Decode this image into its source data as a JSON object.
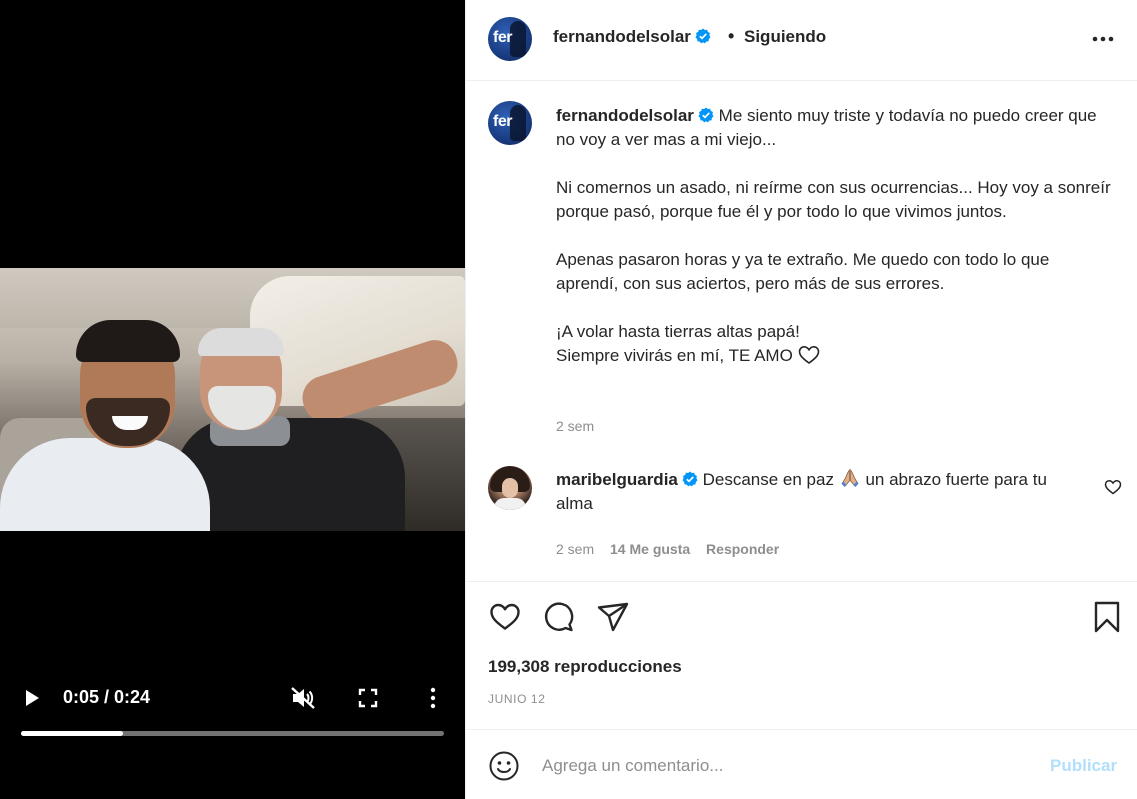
{
  "video": {
    "time_display": "0:05 / 0:24",
    "progress": 0.24,
    "muted": true
  },
  "header": {
    "username": "fernandodelsolar",
    "avatar_text": "fer",
    "separator": "•",
    "follow_status": "Siguiendo"
  },
  "caption": {
    "username": "fernandodelsolar",
    "paragraphs": [
      "Me siento muy triste y todavía no puedo creer que no voy a ver mas a mi viejo...",
      "Ni comernos un asado, ni reírme con sus ocurrencias... Hoy voy a sonreír porque pasó, porque fue él y por todo lo que vivimos juntos.",
      "Apenas pasaron horas y ya te extraño. Me quedo con todo lo que aprendí, con sus aciertos, pero más de sus errores.",
      "¡A volar hasta tierras altas papá!",
      "Siempre vivirás en mí, TE AMO"
    ],
    "time": "2 sem"
  },
  "comment": {
    "username": "maribelguardia",
    "text_before": "Descanse en paz",
    "text_after": "un abrazo fuerte para tu alma",
    "time": "2 sem",
    "likes": "14 Me gusta",
    "reply_label": "Responder"
  },
  "stats": {
    "views": "199,308 reproducciones",
    "date": "JUNIO 12"
  },
  "add_comment": {
    "placeholder": "Agrega un comentario...",
    "publish_label": "Publicar"
  },
  "colors": {
    "verified": "#0095f6",
    "text": "#262626",
    "muted_text": "#8e8e8e",
    "publish_disabled": "#b2dffc",
    "divider": "#efefef"
  },
  "icons": {
    "play": "play-icon",
    "mute": "muted-speaker-icon",
    "fullscreen": "fullscreen-icon",
    "video_more": "vertical-dots-icon",
    "post_more": "horizontal-dots-icon",
    "verified": "verified-badge-icon",
    "like": "heart-icon",
    "comment": "speech-bubble-icon",
    "share": "paper-plane-icon",
    "save": "bookmark-icon",
    "emoji": "smiley-icon"
  }
}
